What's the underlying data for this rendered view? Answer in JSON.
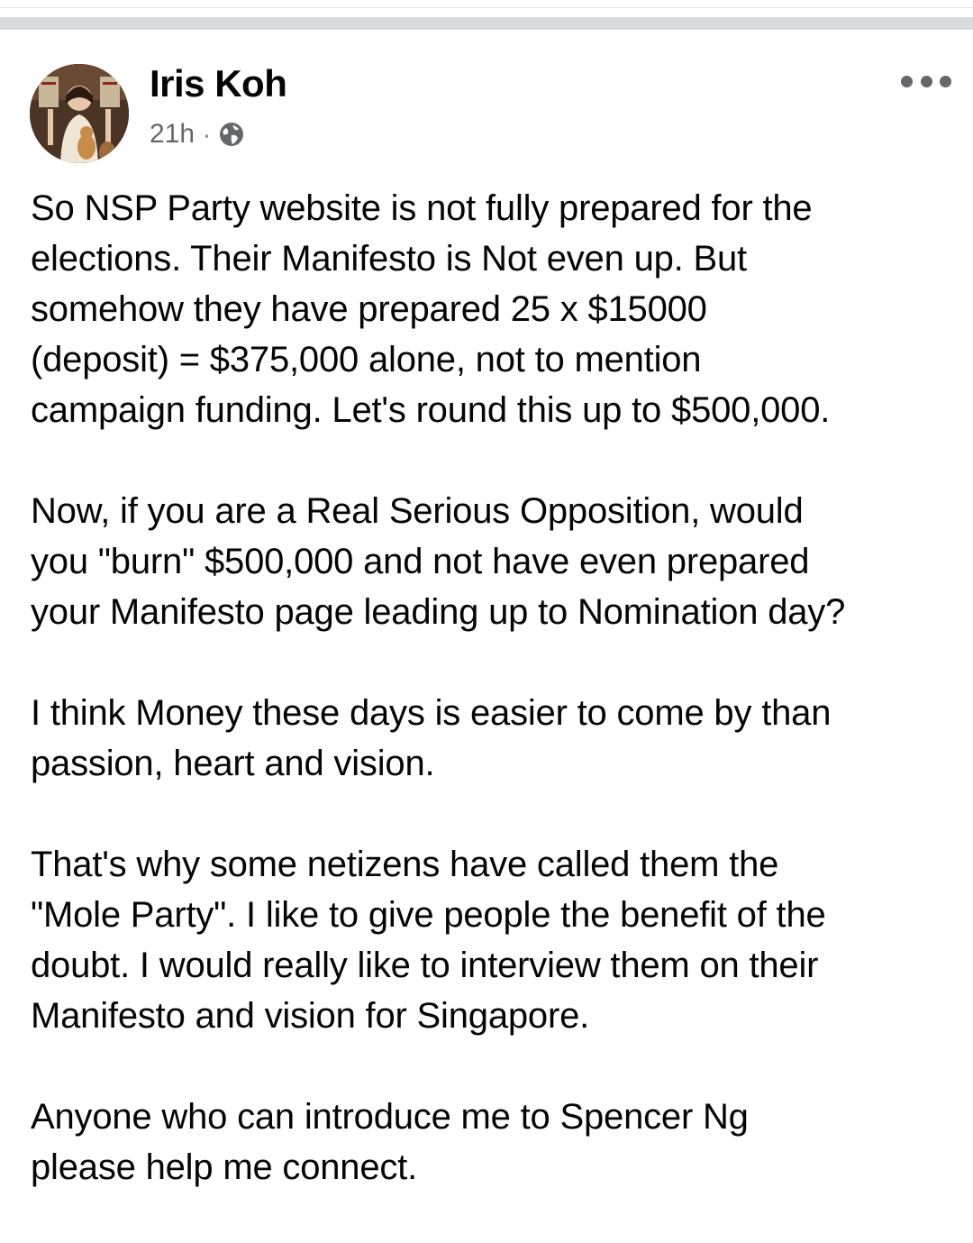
{
  "post": {
    "author": "Iris Koh",
    "time": "21h",
    "separator": "·",
    "privacy_icon": "globe-icon",
    "more_icon": "more-options-icon",
    "paragraphs": [
      "So NSP Party website is not fully prepared for the\nelections. Their Manifesto is Not even up. But\nsomehow they have prepared 25 x $15000\n(deposit) = $375,000 alone, not to mention\ncampaign funding. Let's round this up to $500,000.",
      "Now, if you are a Real Serious Opposition, would\nyou \"burn\" $500,000 and not have even prepared\nyour Manifesto page leading up to Nomination day?",
      "I think Money these days is easier to come by than\npassion, heart and vision.",
      "That's why some netizens have called them the\n\"Mole Party\". I like to give people the benefit of the\ndoubt. I would really like to interview them on their\nManifesto and vision for Singapore.",
      "Anyone who can introduce me to Spencer Ng\nplease help me connect."
    ]
  },
  "colors": {
    "text_primary": "#050505",
    "text_secondary": "#65676b",
    "divider": "#d9dbdf"
  }
}
